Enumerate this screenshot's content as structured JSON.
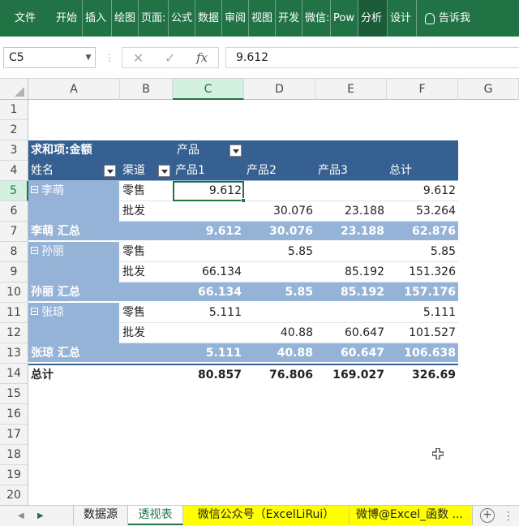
{
  "ribbon": {
    "tabs": [
      "文件",
      "开始",
      "插入",
      "绘图",
      "页面:",
      "公式",
      "数据",
      "审阅",
      "视图",
      "开发",
      "微信:",
      "Pow",
      "分析",
      "设计"
    ],
    "tell_me": "告诉我",
    "accent": "#217346"
  },
  "formula_bar": {
    "name_box": "C5",
    "cancel": "✕",
    "enter": "✓",
    "fx": "fx",
    "value": "9.612"
  },
  "columns": [
    "A",
    "B",
    "C",
    "D",
    "E",
    "F",
    "G"
  ],
  "rows": [
    "1",
    "2",
    "3",
    "4",
    "5",
    "6",
    "7",
    "8",
    "9",
    "10",
    "11",
    "12",
    "13",
    "14",
    "15",
    "16",
    "17",
    "18",
    "19",
    "20"
  ],
  "pivot": {
    "title": "求和项:金额",
    "col_field": "产品",
    "row_field_1": "姓名",
    "row_field_2": "渠道",
    "products": [
      "产品1",
      "产品2",
      "产品3"
    ],
    "grand_total_label": "总计",
    "groups": [
      {
        "name": "李萌",
        "rows": [
          {
            "channel": "零售",
            "values": [
              "9.612",
              "",
              "",
              "9.612"
            ]
          },
          {
            "channel": "批发",
            "values": [
              "",
              "30.076",
              "23.188",
              "53.264"
            ]
          }
        ],
        "subtotal_label": "李萌 汇总",
        "subtotal": [
          "9.612",
          "30.076",
          "23.188",
          "62.876"
        ]
      },
      {
        "name": "孙丽",
        "rows": [
          {
            "channel": "零售",
            "values": [
              "",
              "5.85",
              "",
              "5.85"
            ]
          },
          {
            "channel": "批发",
            "values": [
              "66.134",
              "",
              "85.192",
              "151.326"
            ]
          }
        ],
        "subtotal_label": "孙丽 汇总",
        "subtotal": [
          "66.134",
          "5.85",
          "85.192",
          "157.176"
        ]
      },
      {
        "name": "张琼",
        "rows": [
          {
            "channel": "零售",
            "values": [
              "5.111",
              "",
              "",
              "5.111"
            ]
          },
          {
            "channel": "批发",
            "values": [
              "",
              "40.88",
              "60.647",
              "101.527"
            ]
          }
        ],
        "subtotal_label": "张琼 汇总",
        "subtotal": [
          "5.111",
          "40.88",
          "60.647",
          "106.638"
        ]
      }
    ],
    "grand_total": [
      "80.857",
      "76.806",
      "169.027",
      "326.69"
    ],
    "colors": {
      "header": "#366092",
      "band": "#95b3d7"
    }
  },
  "sheet_tabs": {
    "tabs": [
      "数据源",
      "透视表",
      "微信公众号（ExcelLiRui）",
      "微博@Excel_函数 ..."
    ],
    "active": "透视表",
    "add": "+"
  }
}
